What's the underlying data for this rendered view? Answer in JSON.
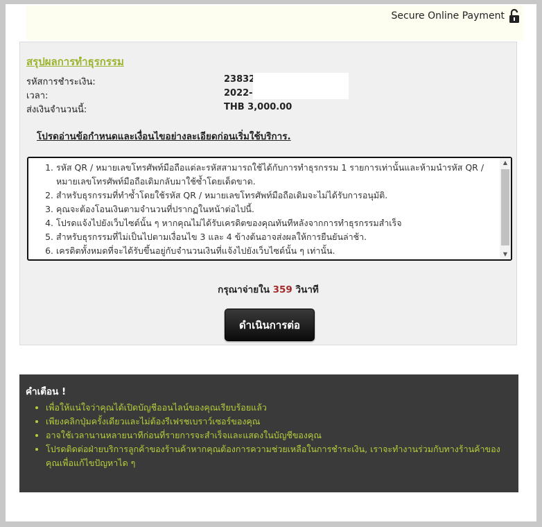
{
  "header": {
    "secure_label": "Secure Online Payment",
    "lock_icon": "lock-icon"
  },
  "summary": {
    "title": "สรุปผลการทำธุรกรรม",
    "rows": [
      {
        "label": "รหัสการชำระเงิน:",
        "value": "23832"
      },
      {
        "label": "เวลา:",
        "value": "2022-"
      },
      {
        "label": "ส่งเงินจำนวนนี้:",
        "value": "THB 3,000.00"
      }
    ],
    "notice": "โปรดอ่านข้อกำหนดและเงื่อนไขอย่างละเอียดก่อนเริ่มใช้บริการ."
  },
  "terms": [
    "รหัส QR / หมายเลขโทรศัพท์มือถือแต่ละรหัสสามารถใช้ได้กับการทำธุรกรรม 1 รายการเท่านั้นและห้ามนำรหัส QR / หมายเลขโทรศัพท์มือถือเดิมกลับมาใช้ซ้ำโดยเด็ดขาด.",
    "สำหรับธุรกรรมที่ทำซ้ำโดยใช้รหัส QR / หมายเลขโทรศัพท์มือถือเดิมจะไม่ได้รับการอนุมัติ.",
    "คุณจะต้องโอนเงินตามจำนวนที่ปรากฏในหน้าต่อไปนี้.",
    "โปรดแจ้งไปยังเว็บไซต์นั้น ๆ หากคุณไม่ได้รับเครดิตของคุณทันทีหลังจากการทำธุรกรรมสำเร็จ",
    "สำหรับธุรกรรมที่ไม่เป็นไปตามเงื่อนไข 3 และ 4 ข้างต้นอาจส่งผลให้การยืนยันล่าช้า.",
    "เครดิตทั้งหมดที่จะได้รับขึ้นอยู่กับจำนวนเงินที่แจ้งไปยังเว็บไซต์นั้น ๆ เท่านั้น."
  ],
  "timer": {
    "prefix": "กรุณาจ่ายใน",
    "seconds": "359",
    "suffix": "วินาที"
  },
  "continue_label": "ดำเนินการต่อ",
  "warning": {
    "title": "คำเตือน !",
    "items": [
      "เพื่อให้แน่ใจว่าคุณได้เปิดบัญชีออนไลน์ของคุณเรียบร้อยแล้ว",
      "เพียงคลิกปุ่มครั้งเดียวและไม่ต้องรีเฟรชเบราว์เซอร์ของคุณ",
      "อาจใช้เวลานานหลายนาทีก่อนที่รายการจะสำเร็จและแสดงในบัญชีของคุณ",
      "โปรดติดต่อฝ่ายบริการลูกค้าของร้านค้าหากคุณต้องการความช่วยเหลือในการชำระเงิน, เราจะทำงานร่วมกับทางร้านค้าของคุณเพื่อแก้ไขปัญหาได ๆ"
    ]
  },
  "colors": {
    "accent_green": "#9ab42e",
    "warning_text": "#b5cf3b",
    "timer_red": "#a52a2a",
    "warning_bg": "#3a3a3a"
  }
}
